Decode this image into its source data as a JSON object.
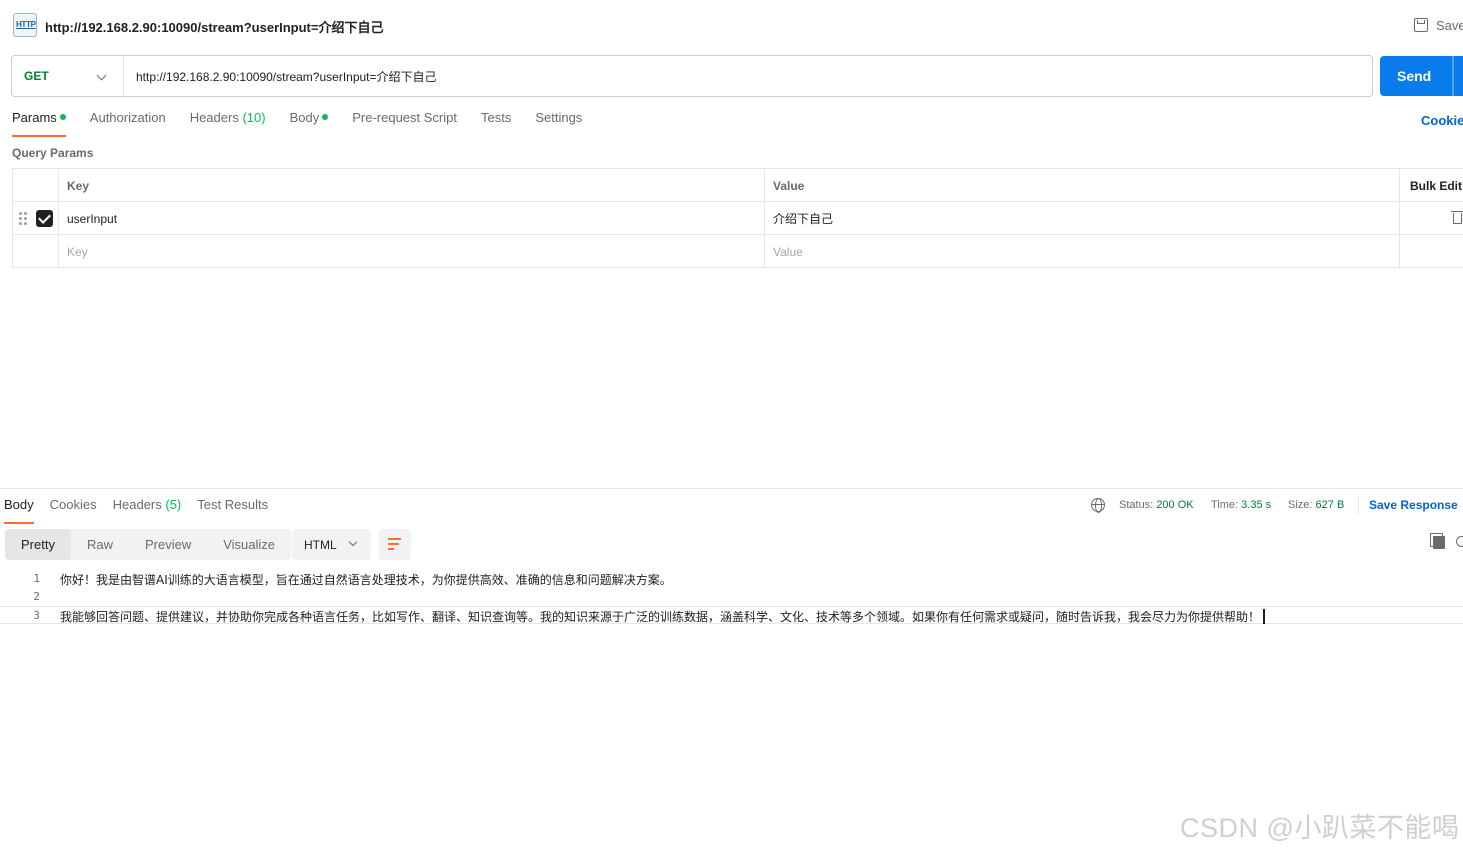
{
  "title_bar": {
    "badge_text": "HTTP",
    "url": "http://192.168.2.90:10090/stream?userInput=介绍下自己",
    "save_label": "Save"
  },
  "request": {
    "method": "GET",
    "url": "http://192.168.2.90:10090/stream?userInput=介绍下自己",
    "send_label": "Send"
  },
  "request_tabs": {
    "params": "Params",
    "authorization": "Authorization",
    "headers": "Headers",
    "headers_count": "(10)",
    "body": "Body",
    "pre_request": "Pre-request Script",
    "tests": "Tests",
    "settings": "Settings",
    "cookies": "Cookies"
  },
  "query_params": {
    "title": "Query Params",
    "header_key": "Key",
    "header_value": "Value",
    "bulk_edit": "Bulk Edit",
    "rows": [
      {
        "key": "userInput",
        "value": "介绍下自己",
        "checked": true
      }
    ],
    "key_placeholder": "Key",
    "value_placeholder": "Value"
  },
  "response_tabs": {
    "body": "Body",
    "cookies": "Cookies",
    "headers": "Headers",
    "headers_count": "(5)",
    "test_results": "Test Results"
  },
  "response_meta": {
    "status_label": "Status:",
    "status_value": "200 OK",
    "time_label": "Time:",
    "time_value": "3.35 s",
    "size_label": "Size:",
    "size_value": "627 B",
    "save_response": "Save Response"
  },
  "view_modes": [
    "Pretty",
    "Raw",
    "Preview",
    "Visualize"
  ],
  "format": "HTML",
  "response_body": [
    {
      "num": "1",
      "text": "你好！我是由智谱AI训练的大语言模型，旨在通过自然语言处理技术，为你提供高效、准确的信息和问题解决方案。"
    },
    {
      "num": "2",
      "text": ""
    },
    {
      "num": "3",
      "text": "我能够回答问题、提供建议，并协助你完成各种语言任务，比如写作、翻译、知识查询等。我的知识来源于广泛的训练数据，涵盖科学、文化、技术等多个领域。如果你有任何需求或疑问，随时告诉我，我会尽力为你提供帮助！"
    }
  ],
  "watermark": "CSDN @小趴菜不能喝",
  "colors": {
    "accent": "#ff6c37",
    "send": "#097bed",
    "method_get": "#007f31",
    "green_dot": "#0cbb52",
    "link": "#0265d2"
  }
}
